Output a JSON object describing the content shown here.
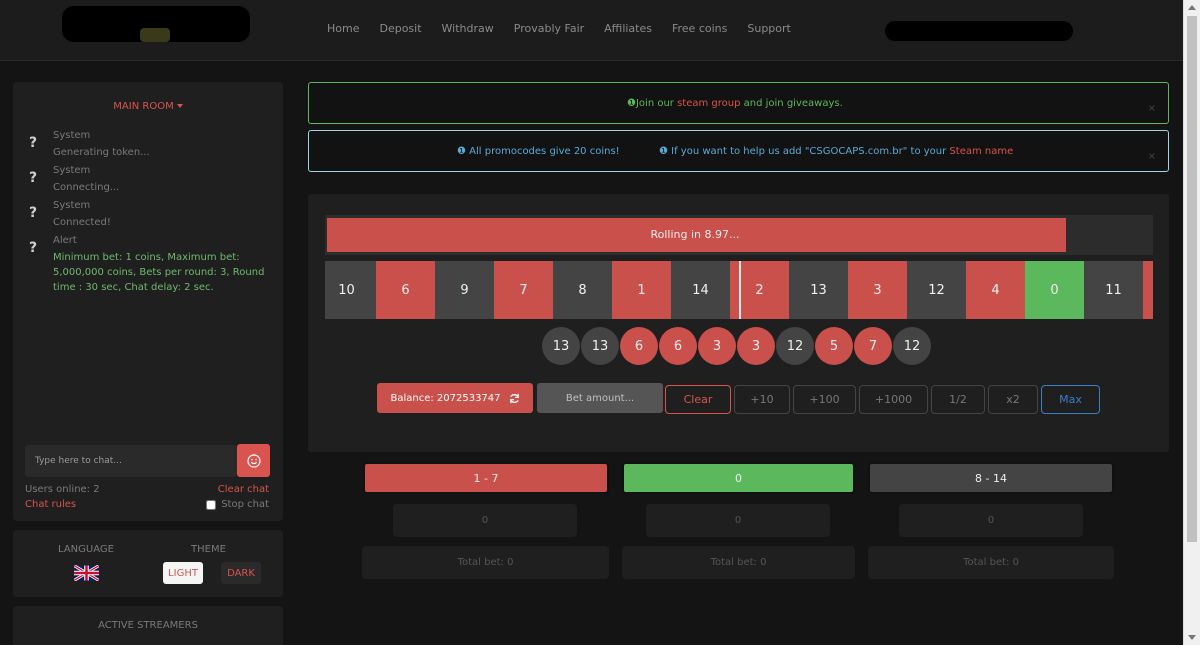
{
  "nav": {
    "links": [
      "Home",
      "Deposit",
      "Withdraw",
      "Provably Fair",
      "Affiliates",
      "Free coins",
      "Support"
    ]
  },
  "chat": {
    "room": "MAIN ROOM",
    "messages": [
      {
        "icon": "?",
        "author": "System",
        "text": "Generating token..."
      },
      {
        "icon": "?",
        "author": "System",
        "text": "Connecting..."
      },
      {
        "icon": "?",
        "author": "System",
        "text": "Connected!"
      },
      {
        "icon": "?",
        "author": "Alert",
        "text": "Minimum bet: 1 coins, Maximum bet: 5,000,000 coins, Bets per round: 3, Round time : 30 sec, Chat delay: 2 sec."
      }
    ],
    "input_placeholder": "Type here to chat...",
    "users_online": "Users online: 2",
    "chat_rules": "Chat rules",
    "clear_chat": "Clear chat",
    "stop_chat": "Stop chat"
  },
  "settings": {
    "language_label": "LANGUAGE",
    "theme_label": "THEME",
    "light": "LIGHT",
    "dark": "DARK"
  },
  "streamers": {
    "label": "ACTIVE STREAMERS"
  },
  "alerts": {
    "green": {
      "icon": "❶",
      "pre": "Join our ",
      "link": "steam group",
      "post": " and join giveaways."
    },
    "blue1": {
      "icon": "❶",
      "text": " All promocodes give 20 coins!"
    },
    "blue2": {
      "icon": "❶",
      "pre": " If you want to help us add \"CSGOCAPS.com.br\" to your ",
      "link": "Steam name"
    },
    "close": "×"
  },
  "game": {
    "rolling_text": "Rolling in 8.97...",
    "progress": 0.897,
    "strip": [
      {
        "n": "10",
        "c": "black"
      },
      {
        "n": "6",
        "c": "red"
      },
      {
        "n": "9",
        "c": "black"
      },
      {
        "n": "7",
        "c": "red"
      },
      {
        "n": "8",
        "c": "black"
      },
      {
        "n": "1",
        "c": "red"
      },
      {
        "n": "14",
        "c": "black"
      },
      {
        "n": "2",
        "c": "red"
      },
      {
        "n": "13",
        "c": "black"
      },
      {
        "n": "3",
        "c": "red"
      },
      {
        "n": "12",
        "c": "black"
      },
      {
        "n": "4",
        "c": "red"
      },
      {
        "n": "0",
        "c": "green"
      },
      {
        "n": "11",
        "c": "black"
      },
      {
        "n": "",
        "c": "red"
      }
    ],
    "history": [
      {
        "n": "13",
        "c": "black"
      },
      {
        "n": "13",
        "c": "black"
      },
      {
        "n": "6",
        "c": "red"
      },
      {
        "n": "6",
        "c": "red"
      },
      {
        "n": "3",
        "c": "red"
      },
      {
        "n": "3",
        "c": "red"
      },
      {
        "n": "12",
        "c": "black"
      },
      {
        "n": "5",
        "c": "red"
      },
      {
        "n": "7",
        "c": "red"
      },
      {
        "n": "12",
        "c": "black"
      }
    ],
    "balance": "Balance: 2072533747",
    "bet_placeholder": "Bet amount...",
    "buttons": [
      "Clear",
      "+10",
      "+100",
      "+1000",
      "1/2",
      "x2",
      "Max"
    ]
  },
  "bets": [
    {
      "label": "1 - 7",
      "color": "red",
      "amount": "0",
      "total": "Total bet: 0"
    },
    {
      "label": "0",
      "color": "green",
      "amount": "0",
      "total": "Total bet: 0"
    },
    {
      "label": "8 - 14",
      "color": "black",
      "amount": "0",
      "total": "Total bet: 0"
    }
  ],
  "colors": {
    "red": "#c9504b",
    "green": "#5cb85c",
    "black": "#444444",
    "accent": "#d9534f",
    "blue": "#3b7dc9"
  }
}
